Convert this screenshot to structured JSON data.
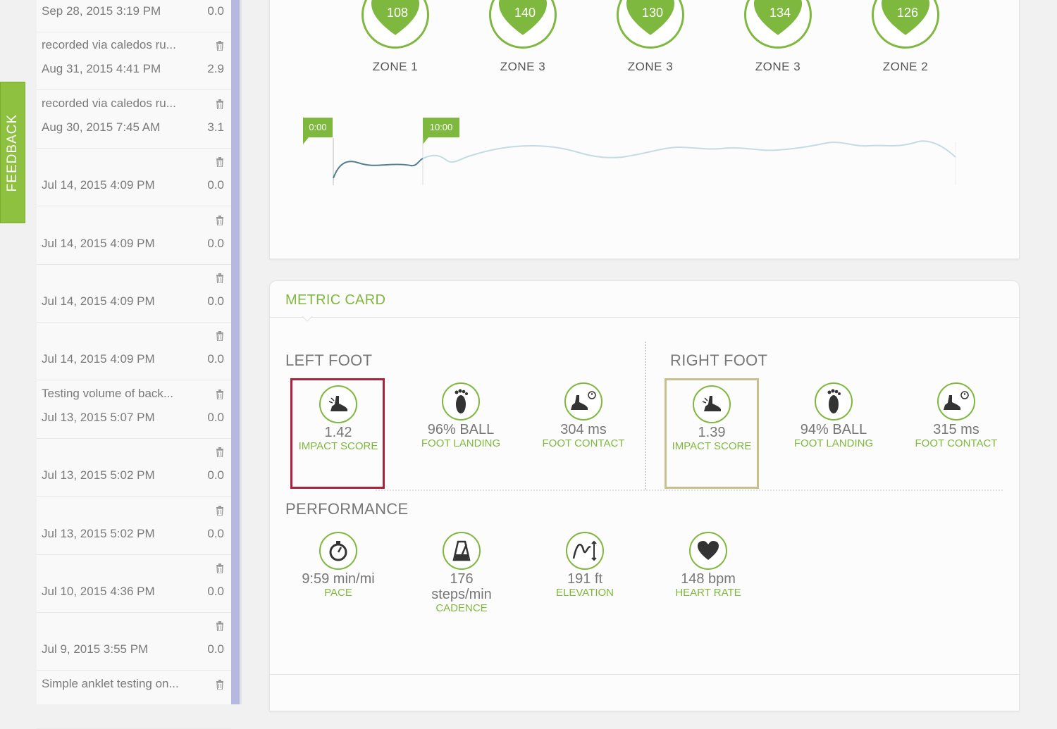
{
  "feedback": {
    "label": "FEEDBACK"
  },
  "sidebar": {
    "runs": [
      {
        "title": "",
        "date": "Sep 28, 2015 3:19 PM",
        "distance": "0.0"
      },
      {
        "title": "recorded via caledos ru...",
        "date": "Aug 31, 2015 4:41 PM",
        "distance": "2.9"
      },
      {
        "title": "recorded via caledos ru...",
        "date": "Aug 30, 2015 7:45 AM",
        "distance": "3.1"
      },
      {
        "title": "",
        "date": "Jul 14, 2015 4:09 PM",
        "distance": "0.0"
      },
      {
        "title": "",
        "date": "Jul 14, 2015 4:09 PM",
        "distance": "0.0"
      },
      {
        "title": "",
        "date": "Jul 14, 2015 4:09 PM",
        "distance": "0.0"
      },
      {
        "title": "",
        "date": "Jul 14, 2015 4:09 PM",
        "distance": "0.0"
      },
      {
        "title": "Testing volume of back...",
        "date": "Jul 13, 2015 5:07 PM",
        "distance": "0.0"
      },
      {
        "title": "",
        "date": "Jul 13, 2015 5:02 PM",
        "distance": "0.0"
      },
      {
        "title": "",
        "date": "Jul 13, 2015 5:02 PM",
        "distance": "0.0"
      },
      {
        "title": "",
        "date": "Jul 10, 2015 4:36 PM",
        "distance": "0.0"
      },
      {
        "title": "",
        "date": "Jul 9, 2015 3:55 PM",
        "distance": "0.0"
      },
      {
        "title": "Simple anklet testing on...",
        "date": "",
        "distance": ""
      }
    ]
  },
  "zones": [
    {
      "value": "108",
      "label": "ZONE 1"
    },
    {
      "value": "140",
      "label": "ZONE 3"
    },
    {
      "value": "130",
      "label": "ZONE 3"
    },
    {
      "value": "134",
      "label": "ZONE 3"
    },
    {
      "value": "126",
      "label": "ZONE 2"
    }
  ],
  "timeline": {
    "start_label": "0:00",
    "split_label": "10:00"
  },
  "metric_card": {
    "title": "METRIC CARD",
    "left_foot": {
      "title": "LEFT FOOT",
      "impact_value": "1.42",
      "impact_label": "IMPACT SCORE",
      "landing_value": "96% BALL",
      "landing_label": "FOOT LANDING",
      "contact_value": "304 ms",
      "contact_label": "FOOT CONTACT"
    },
    "right_foot": {
      "title": "RIGHT FOOT",
      "impact_value": "1.39",
      "impact_label": "IMPACT SCORE",
      "landing_value": "94% BALL",
      "landing_label": "FOOT LANDING",
      "contact_value": "315 ms",
      "contact_label": "FOOT CONTACT"
    },
    "performance": {
      "title": "PERFORMANCE",
      "pace_value": "9:59 min/mi",
      "pace_label": "PACE",
      "cadence_value": "176",
      "cadence_unit": "steps/min",
      "cadence_label": "CADENCE",
      "elevation_value": "191 ft",
      "elevation_label": "ELEVATION",
      "hr_value": "148 bpm",
      "hr_label": "HEART RATE"
    }
  },
  "colors": {
    "accent": "#7fb83e",
    "left_impact_border": "#b0203a",
    "right_impact_border": "#c8c08a",
    "scrollbar": "#b6b8e0"
  }
}
